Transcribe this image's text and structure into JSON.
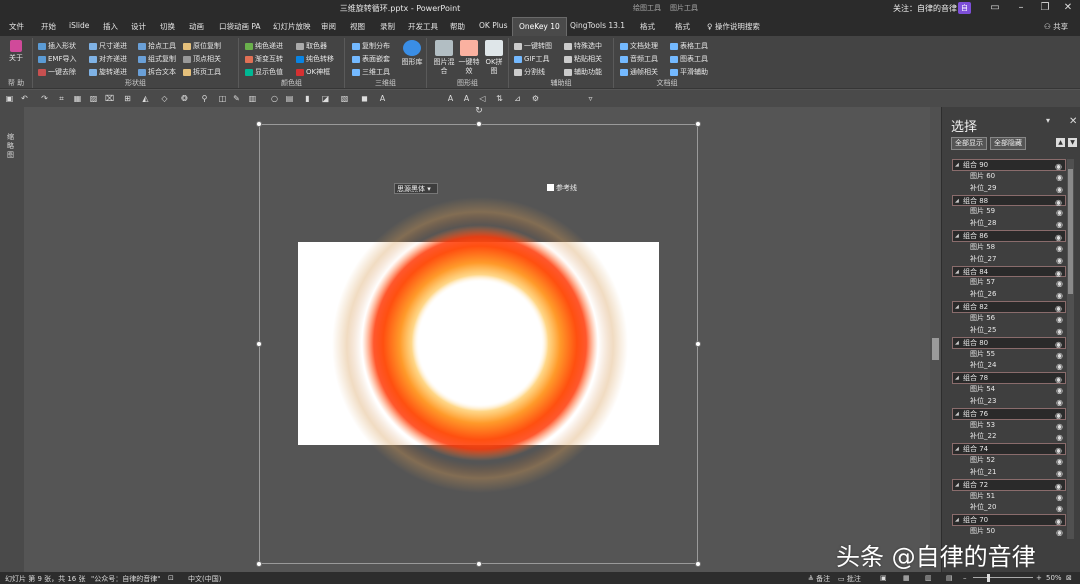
{
  "titlebar": {
    "doc_title": "三维旋转循环.pptx  -  PowerPoint",
    "context_tab_drawing": "绘图工具",
    "context_tab_picture": "图片工具",
    "follow_text": "关注：自律的音律",
    "avatar": "自"
  },
  "tabs": [
    {
      "label": "文件",
      "active": false
    },
    {
      "label": "开始",
      "active": false
    },
    {
      "label": "iSlide",
      "active": false
    },
    {
      "label": "插入",
      "active": false
    },
    {
      "label": "设计",
      "active": false
    },
    {
      "label": "切换",
      "active": false
    },
    {
      "label": "动画",
      "active": false
    },
    {
      "label": "口袋动画 PA",
      "active": false
    },
    {
      "label": "幻灯片放映",
      "active": false
    },
    {
      "label": "审阅",
      "active": false
    },
    {
      "label": "视图",
      "active": false
    },
    {
      "label": "录制",
      "active": false
    },
    {
      "label": "开发工具",
      "active": false
    },
    {
      "label": "帮助",
      "active": false
    },
    {
      "label": "OK Plus",
      "active": false
    },
    {
      "label": "OneKey 10",
      "active": true
    },
    {
      "label": "QingTools 13.1",
      "active": false
    },
    {
      "label": "格式",
      "active": false
    },
    {
      "label": "格式",
      "active": false
    }
  ],
  "tell_me": "操作说明搜索",
  "share": "共享",
  "ribbon": {
    "about": {
      "label": "关于",
      "group": "帮 助"
    },
    "shape_group": {
      "label": "形状组",
      "items": [
        "插入形状",
        "尺寸递进",
        "拾点工具",
        "原位复制",
        "EMF导入",
        "对齐递进",
        "组式复制",
        "顶点相关",
        "一键去除",
        "旋转递进",
        "拆合文本",
        "拆页工具"
      ]
    },
    "color_group": {
      "label": "颜色组",
      "items": [
        "纯色递进",
        "取色器",
        "渐变互转",
        "纯色转移",
        "显示色值",
        "OK神框"
      ]
    },
    "3d_group": {
      "label": "三维组",
      "items": [
        "复制分布",
        "表面嵌套",
        "三维工具"
      ],
      "big": "图形库"
    },
    "image_group": {
      "label": "图形组",
      "items": [
        "图片混合",
        "一键特效",
        "OK拼图"
      ]
    },
    "aux_group": {
      "label": "辅助组",
      "items": [
        "一键转图",
        "特殊选中",
        "GIF工具",
        "粘贴相关",
        "分割线",
        "辅助功能"
      ]
    },
    "doc_group": {
      "label": "文档组",
      "items": [
        "文档处理",
        "表格工具",
        "音频工具",
        "图表工具",
        "通帧相关",
        "平滑辅助"
      ]
    }
  },
  "qat": {
    "font": "思源黑体",
    "ref_line": "参考线"
  },
  "left_panel_label": "缩略图",
  "selection_pane": {
    "title": "选择",
    "show_all": "全部显示",
    "hide_all": "全部隐藏",
    "rows": [
      {
        "label": "组合 90",
        "type": "group"
      },
      {
        "label": "图片 60",
        "type": "sub"
      },
      {
        "label": "补位_29",
        "type": "sub"
      },
      {
        "label": "组合 88",
        "type": "group"
      },
      {
        "label": "图片 59",
        "type": "sub"
      },
      {
        "label": "补位_28",
        "type": "sub"
      },
      {
        "label": "组合 86",
        "type": "group"
      },
      {
        "label": "图片 58",
        "type": "sub"
      },
      {
        "label": "补位_27",
        "type": "sub"
      },
      {
        "label": "组合 84",
        "type": "group"
      },
      {
        "label": "图片 57",
        "type": "sub"
      },
      {
        "label": "补位_26",
        "type": "sub"
      },
      {
        "label": "组合 82",
        "type": "group"
      },
      {
        "label": "图片 56",
        "type": "sub"
      },
      {
        "label": "补位_25",
        "type": "sub"
      },
      {
        "label": "组合 80",
        "type": "group"
      },
      {
        "label": "图片 55",
        "type": "sub"
      },
      {
        "label": "补位_24",
        "type": "sub"
      },
      {
        "label": "组合 78",
        "type": "group"
      },
      {
        "label": "图片 54",
        "type": "sub"
      },
      {
        "label": "补位_23",
        "type": "sub"
      },
      {
        "label": "组合 76",
        "type": "group"
      },
      {
        "label": "图片 53",
        "type": "sub"
      },
      {
        "label": "补位_22",
        "type": "sub"
      },
      {
        "label": "组合 74",
        "type": "group"
      },
      {
        "label": "图片 52",
        "type": "sub"
      },
      {
        "label": "补位_21",
        "type": "sub"
      },
      {
        "label": "组合 72",
        "type": "group"
      },
      {
        "label": "图片 51",
        "type": "sub"
      },
      {
        "label": "补位_20",
        "type": "sub"
      },
      {
        "label": "组合 70",
        "type": "group"
      },
      {
        "label": "图片 50",
        "type": "sub"
      }
    ]
  },
  "status": {
    "slide_info": "幻灯片 第 9 张，共 16 张",
    "tag": "\"公众号：自律的音律\"",
    "lang": "中文(中国)",
    "notes": "备注",
    "comments": "批注",
    "zoom": "50%"
  },
  "watermark": "头条 @自律的音律",
  "colors": {
    "accent_tab": "#4a4a4a",
    "ring_outer": "#ff4a0a",
    "ring_inner": "#ffc24a"
  }
}
